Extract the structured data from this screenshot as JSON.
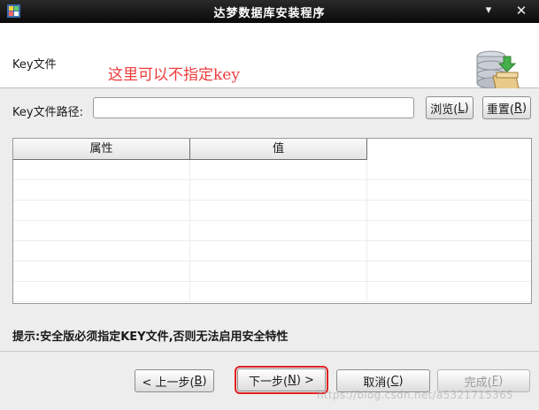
{
  "window": {
    "title": "达梦数据库安装程序",
    "minimize_glyph": "▾",
    "close_glyph": "✕"
  },
  "header": {
    "step_title": "Key文件",
    "annotation": "这里可以不指定key",
    "icon": "database-install-icon"
  },
  "key_path": {
    "label": "Key文件路径:",
    "value": "",
    "placeholder": "",
    "browse_label_prefix": "浏览(",
    "browse_mnemonic": "L",
    "browse_label_suffix": ")",
    "reset_label_prefix": "重置(",
    "reset_mnemonic": "R",
    "reset_label_suffix": ")"
  },
  "table": {
    "columns": [
      "属性",
      "值"
    ],
    "rows": []
  },
  "hint": "提示:安全版必须指定KEY文件,否则无法启用安全特性",
  "footer": {
    "prev": {
      "prefix": "< 上一步(",
      "mnemonic": "B",
      "suffix": ")"
    },
    "next": {
      "prefix": "下一步(",
      "mnemonic": "N",
      "suffix": ") >"
    },
    "cancel": {
      "prefix": "取消(",
      "mnemonic": "C",
      "suffix": ")"
    },
    "finish": {
      "prefix": "完成(",
      "mnemonic": "F",
      "suffix": ")"
    }
  },
  "watermark": "https://blog.csdn.net/a5321715365",
  "colors": {
    "annotation": "#ee3b3b",
    "highlight_box": "#e02020",
    "titlebar": "#111111"
  }
}
